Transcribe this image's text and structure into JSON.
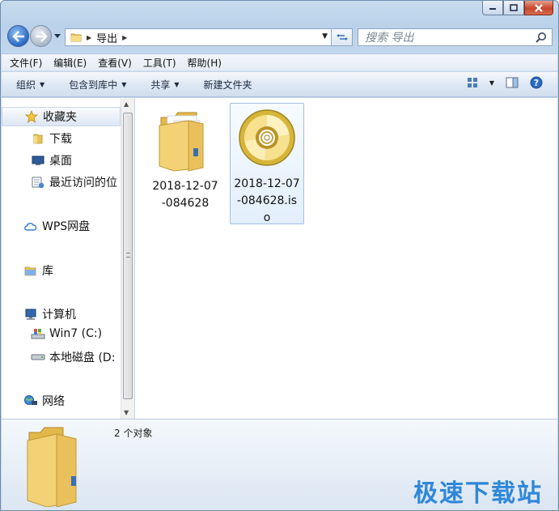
{
  "window": {
    "caption_buttons": {
      "minimize": "minimize",
      "maximize": "maximize",
      "close": "close"
    }
  },
  "address": {
    "crumbs": [
      "导出"
    ],
    "search_placeholder": "搜索 导出"
  },
  "menubar": {
    "items": [
      "文件(F)",
      "编辑(E)",
      "查看(V)",
      "工具(T)",
      "帮助(H)"
    ]
  },
  "commandbar": {
    "items": [
      "组织",
      "包含到库中",
      "共享",
      "新建文件夹"
    ]
  },
  "navpane": {
    "items": [
      {
        "label": "收藏夹",
        "icon": "star-icon"
      },
      {
        "label": "下载",
        "icon": "downloads-folder-icon"
      },
      {
        "label": "桌面",
        "icon": "desktop-icon"
      },
      {
        "label": "最近访问的位",
        "icon": "recent-places-icon"
      },
      {
        "label": "WPS网盘",
        "icon": "cloud-icon"
      },
      {
        "label": "库",
        "icon": "library-icon"
      },
      {
        "label": "计算机",
        "icon": "computer-icon"
      },
      {
        "label": "Win7 (C:)",
        "icon": "system-drive-icon"
      },
      {
        "label": "本地磁盘 (D:",
        "icon": "hard-drive-icon"
      },
      {
        "label": "网络",
        "icon": "network-icon"
      }
    ]
  },
  "files": [
    {
      "name": "2018-12-07-084628",
      "type": "folder",
      "icon": "folder-icon"
    },
    {
      "name": "2018-12-07-084628.iso",
      "type": "iso",
      "icon": "disc-image-icon",
      "selected": true
    }
  ],
  "details": {
    "count": "2 个对象",
    "watermark": "极速下载站"
  }
}
